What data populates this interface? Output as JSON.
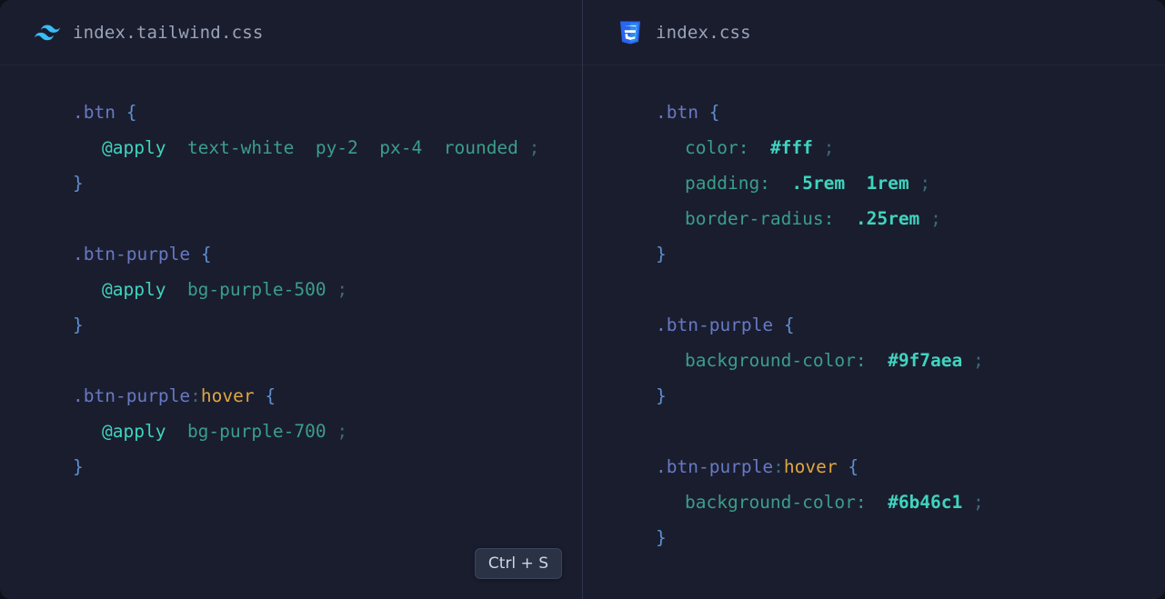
{
  "left": {
    "tab": {
      "icon": "tailwind-icon",
      "title": "index.tailwind.css"
    },
    "code": {
      "r1": {
        "sel": ".btn",
        "open": "{"
      },
      "r2": {
        "dir": "@apply",
        "u1": "text-white",
        "u2": "py-2",
        "u3": "px-4",
        "u4": "rounded",
        "semi": ";"
      },
      "r3": {
        "close": "}"
      },
      "r4": {
        "sel": ".btn-purple",
        "open": "{"
      },
      "r5": {
        "dir": "@apply",
        "u1": "bg-purple-500",
        "semi": ";"
      },
      "r6": {
        "close": "}"
      },
      "r7": {
        "sel": ".btn-purple",
        "colon": ":",
        "pseudo": "hover",
        "open": "{"
      },
      "r8": {
        "dir": "@apply",
        "u1": "bg-purple-700",
        "semi": ";"
      },
      "r9": {
        "close": "}"
      }
    },
    "shortcut": "Ctrl + S"
  },
  "right": {
    "tab": {
      "icon": "css3-icon",
      "title": "index.css"
    },
    "code": {
      "r1": {
        "sel": ".btn",
        "open": "{"
      },
      "r2": {
        "prop": "color:",
        "val": "#fff",
        "semi": ";"
      },
      "r3": {
        "prop": "padding:",
        "v1": ".5rem",
        "v2": "1rem",
        "semi": ";"
      },
      "r4": {
        "prop": "border-radius:",
        "val": ".25rem",
        "semi": ";"
      },
      "r5": {
        "close": "}"
      },
      "r6": {
        "sel": ".btn-purple",
        "open": "{"
      },
      "r7": {
        "prop": "background-color:",
        "val": "#9f7aea",
        "semi": ";"
      },
      "r8": {
        "close": "}"
      },
      "r9": {
        "sel": ".btn-purple",
        "colon": ":",
        "pseudo": "hover",
        "open": "{"
      },
      "r10": {
        "prop": "background-color:",
        "val": "#6b46c1",
        "semi": ";"
      },
      "r11": {
        "close": "}"
      }
    }
  }
}
